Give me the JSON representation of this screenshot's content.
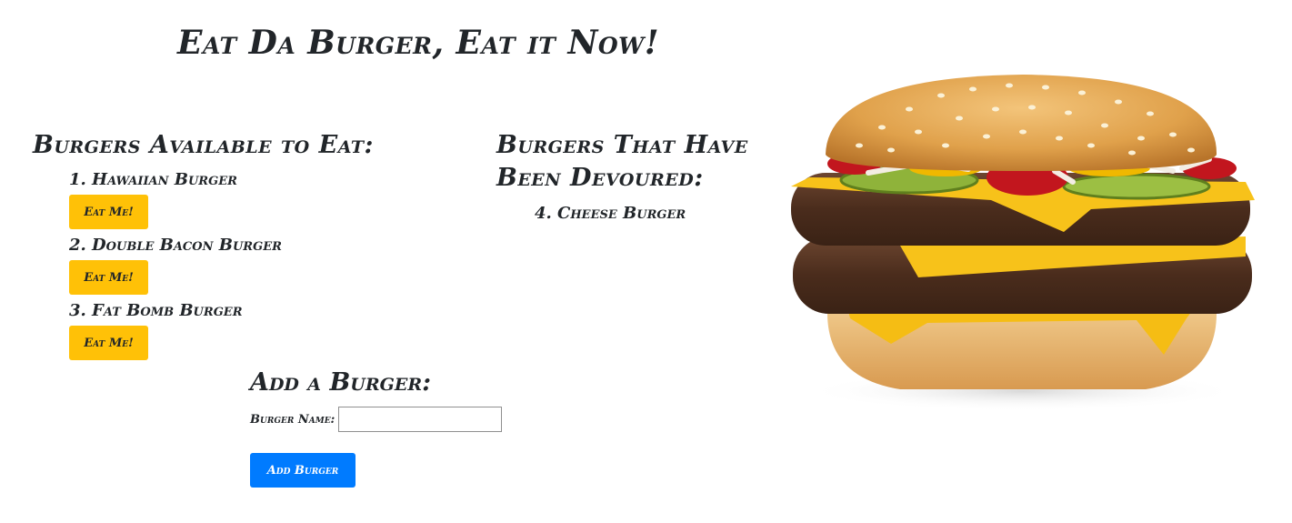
{
  "page": {
    "title": "Eat Da Burger, Eat it Now!"
  },
  "available": {
    "heading": "Burgers Available to Eat:",
    "items": [
      {
        "label": "1. Hawaiian Burger",
        "button": "Eat Me!"
      },
      {
        "label": "2. Double Bacon Burger",
        "button": "Eat Me!"
      },
      {
        "label": "3. Fat Bomb Burger",
        "button": "Eat Me!"
      }
    ]
  },
  "devoured": {
    "heading": "Burgers That Have Been Devoured:",
    "items": [
      {
        "label": "4. Cheese Burger"
      }
    ]
  },
  "add_form": {
    "heading": "Add a Burger:",
    "field_label": "Burger Name:",
    "input_value": "",
    "input_placeholder": "",
    "button": "Add Burger"
  },
  "colors": {
    "eat_button": "#ffc107",
    "add_button": "#007bff",
    "text": "#212529"
  },
  "image": {
    "icon": "double-cheeseburger-photo"
  }
}
